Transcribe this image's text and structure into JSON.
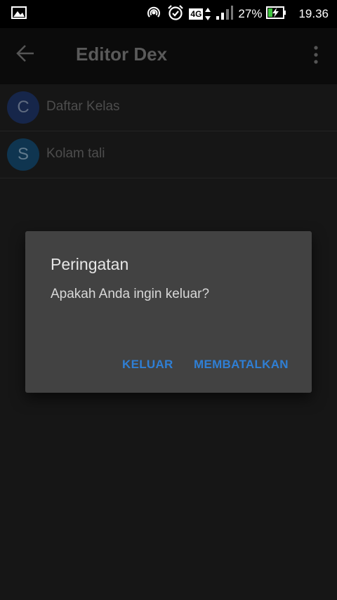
{
  "status_bar": {
    "icons": [
      "gallery-icon",
      "hotspot-icon",
      "alarm-icon",
      "4g-icon",
      "signal-icon",
      "battery-charging-icon"
    ],
    "network": "4G",
    "battery_percent": "27%",
    "time": "19.36"
  },
  "app_bar": {
    "title": "Editor Dex"
  },
  "list": {
    "items": [
      {
        "avatar_letter": "C",
        "label": "Daftar Kelas"
      },
      {
        "avatar_letter": "S",
        "label": "Kolam tali"
      }
    ]
  },
  "dialog": {
    "title": "Peringatan",
    "message": "Apakah Anda ingin keluar?",
    "positive_button": "KELUAR",
    "negative_button": "MEMBATALKAN"
  },
  "colors": {
    "background": "#161616",
    "dialog": "#424242",
    "accent": "#2f7fd4"
  }
}
